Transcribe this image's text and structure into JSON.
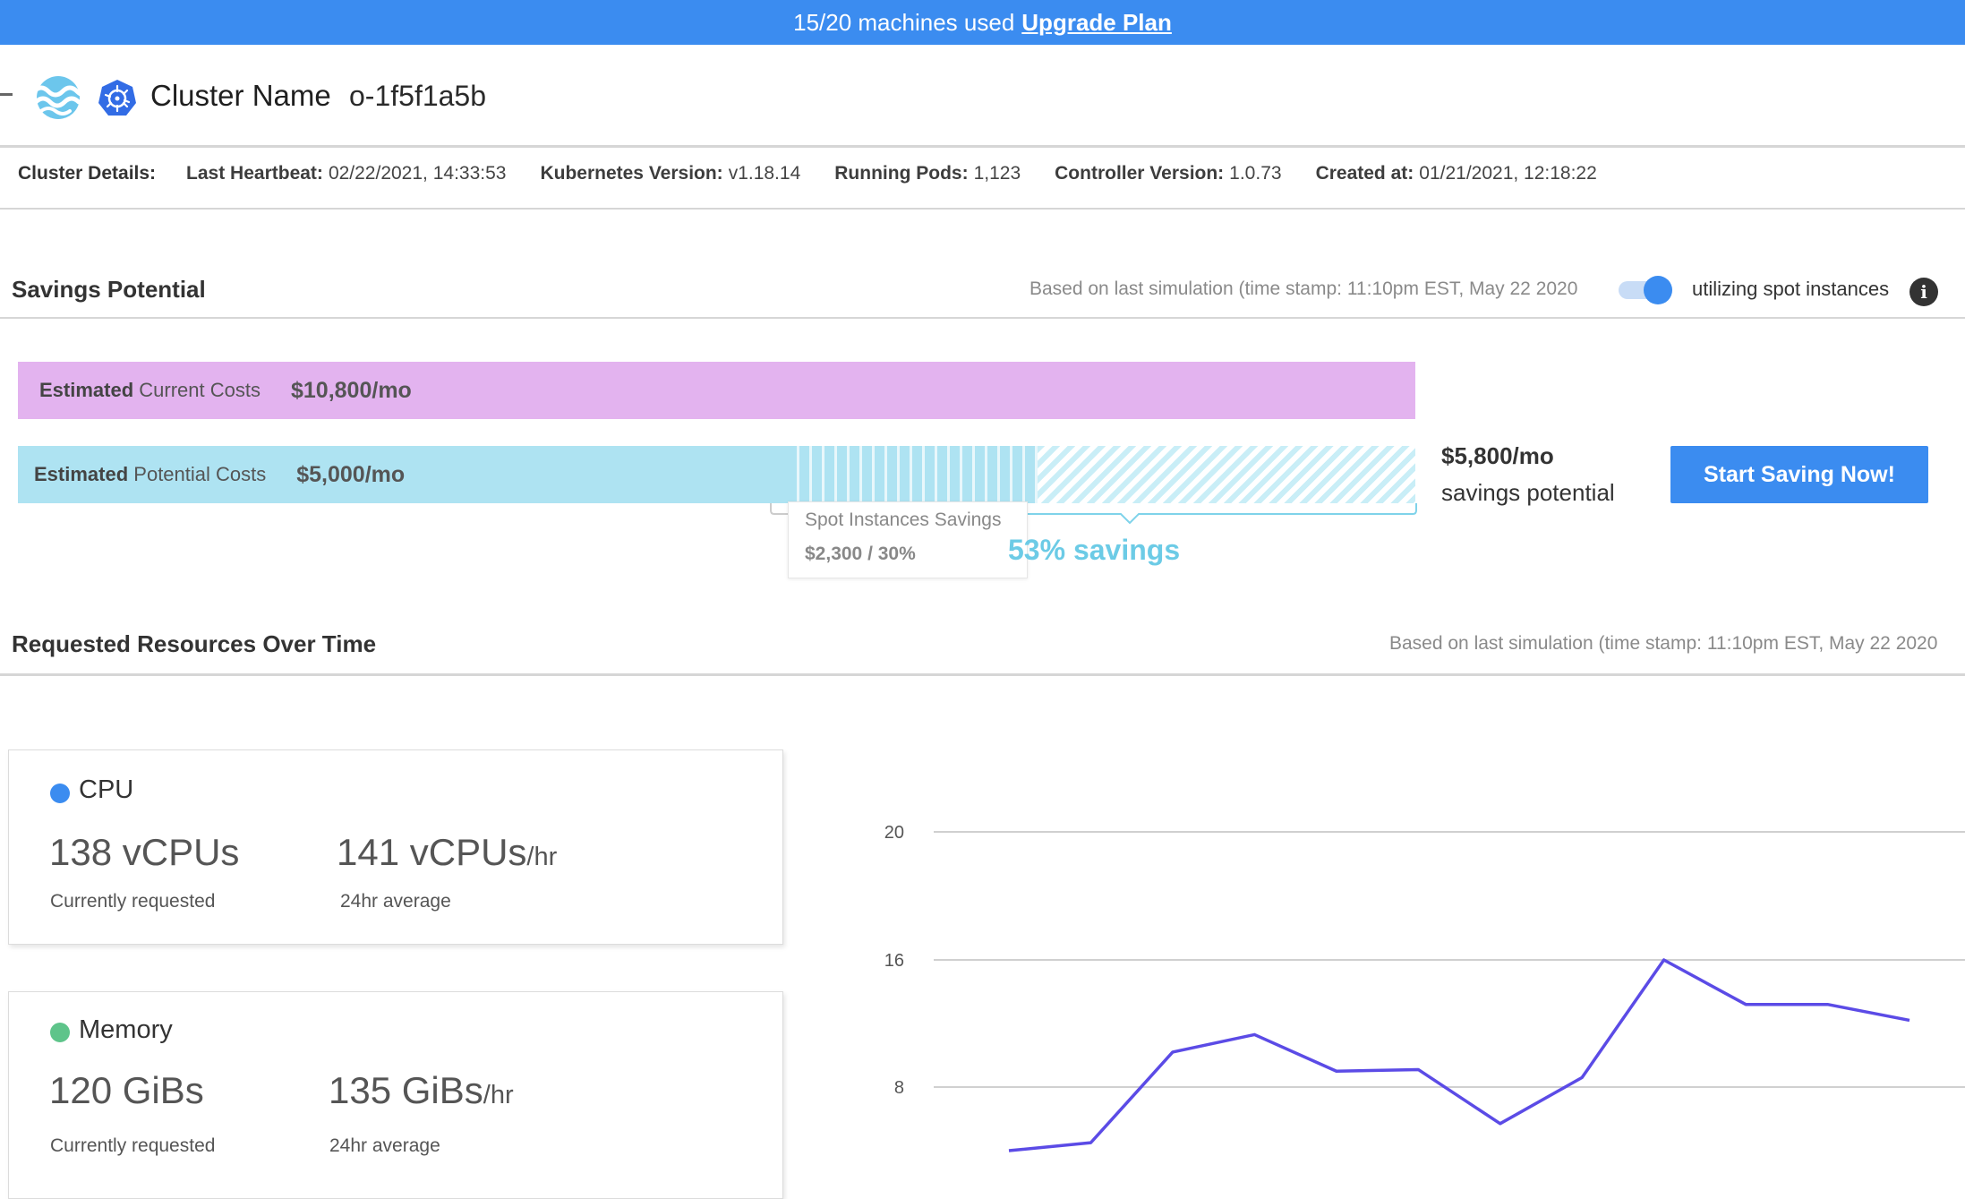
{
  "banner": {
    "text": "15/20 machines used",
    "link": "Upgrade Plan"
  },
  "header": {
    "cluster_label": "Cluster Name",
    "cluster_id": "o-1f5f1a5b"
  },
  "details": {
    "label": "Cluster Details:",
    "items": [
      {
        "key": "Last Heartbeat:",
        "value": "02/22/2021, 14:33:53"
      },
      {
        "key": "Kubernetes Version:",
        "value": "v1.18.14"
      },
      {
        "key": "Running Pods:",
        "value": "1,123"
      },
      {
        "key": "Controller Version:",
        "value": "1.0.73"
      },
      {
        "key": "Created at:",
        "value": "01/21/2021, 12:18:22"
      }
    ]
  },
  "savings": {
    "title": "Savings Potential",
    "note": "Based on last simulation (time stamp: 11:10pm EST, May 22 2020",
    "toggle_on": true,
    "toggle_label": "utilizing spot instances",
    "current_label_bold": "Estimated",
    "current_label_rest": "Current Costs",
    "current_amount": "$10,800/mo",
    "potential_label_bold": "Estimated",
    "potential_label_rest": "Potential Costs",
    "potential_amount": "$5,000/mo",
    "spot_title": "Spot Instances Savings",
    "spot_value": "$2,300 / 30%",
    "percent_savings": "53% savings",
    "savings_amount": "$5,800/mo",
    "savings_sub": "savings potential",
    "start_button": "Start Saving Now!",
    "colors": {
      "current": "#e3b3ef",
      "potential": "#aee3f2",
      "accent": "#3b8cf0"
    }
  },
  "resources": {
    "title": "Requested Resources Over Time",
    "note": "Based on last simulation (time stamp: 11:10pm EST, May 22 2020",
    "cpu": {
      "title": "CPU",
      "color": "#3b8cf0",
      "current_value": "138 vCPUs",
      "current_label": "Currently requested",
      "avg_value": "141 vCPUs",
      "avg_unit": "/hr",
      "avg_label": "24hr average"
    },
    "memory": {
      "title": "Memory",
      "color": "#5ec48a",
      "current_value": "120 GiBs",
      "current_label": "Currently requested",
      "avg_value": "135 GiBs",
      "avg_unit": "/hr",
      "avg_label": "24hr average"
    }
  },
  "chart_data": {
    "type": "line",
    "y_ticks": [
      "20",
      "16",
      "8"
    ],
    "series": [
      {
        "color": "#5b4be6",
        "values": [
          4,
          4.5,
          10.2,
          11.3,
          9.0,
          9.1,
          5.7,
          8.6,
          16,
          13.2,
          13.2,
          12.2
        ]
      }
    ]
  }
}
